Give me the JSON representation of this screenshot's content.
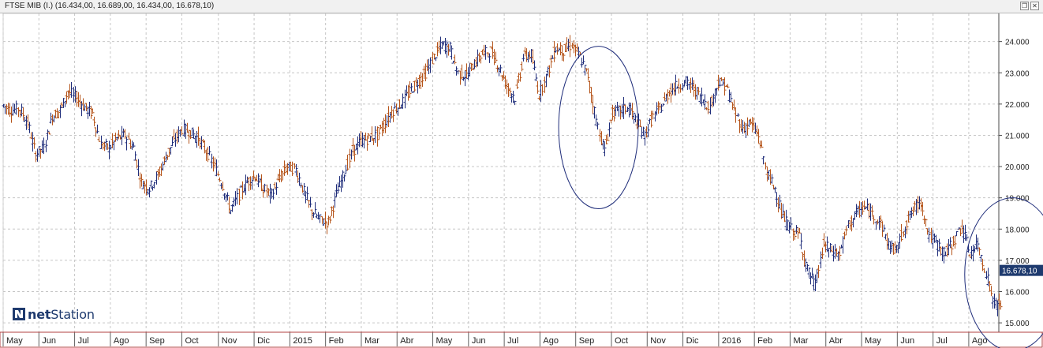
{
  "window": {
    "title": "FTSE MIB (I.) (16.434,00, 16.689,00, 16.434,00, 16.678,10)",
    "restore_glyph": "❐",
    "close_glyph": "✕"
  },
  "logo": {
    "mark": "N",
    "text_bold": "net",
    "text_rest": "Station"
  },
  "colors": {
    "up": "#1f2d7a",
    "down": "#b5541a",
    "grid": "#c6c6c6",
    "axis_line": "#4a4a4a",
    "price_tag": "#1e3a6e",
    "circle": "#1f2d7a",
    "bottom_border": "#b04040"
  },
  "chart_data": {
    "type": "line",
    "style": "ohlc-bars",
    "title": "FTSE MIB (I.)",
    "ylim": [
      14.7,
      24.9
    ],
    "yticks": [
      "15.000",
      "16.000",
      "17.000",
      "18.000",
      "19.000",
      "20.000",
      "21.000",
      "22.000",
      "23.000",
      "24.000"
    ],
    "last_value": "16.678,10",
    "grid": true,
    "xlim": [
      0,
      67.6
    ],
    "x_unit": "week index from start (May 2014)",
    "months": [
      {
        "label": "May",
        "x": 0
      },
      {
        "label": "Jun",
        "x": 4.4
      },
      {
        "label": "Jul",
        "x": 8.8
      },
      {
        "label": "Ago",
        "x": 13.2
      },
      {
        "label": "Sep",
        "x": 17.6
      },
      {
        "label": "Oct",
        "x": 22.0
      },
      {
        "label": "Nov",
        "x": 26.5
      },
      {
        "label": "Dic",
        "x": 30.9
      },
      {
        "label": "2015",
        "x": 35.3
      },
      {
        "label": "Feb",
        "x": 39.7
      },
      {
        "label": "Mar",
        "x": 44.1
      },
      {
        "label": "Abr",
        "x": 48.5
      },
      {
        "label": "May",
        "x": 52.9
      },
      {
        "label": "Jun",
        "x": 57.3
      },
      {
        "label": "Jul",
        "x": 61.7
      },
      {
        "label": "Ago",
        "x": 66.1
      },
      {
        "label": "Sep",
        "x": 70.5
      },
      {
        "label": "Oct",
        "x": 74.9
      },
      {
        "label": "Nov",
        "x": 79.3
      },
      {
        "label": "Dic",
        "x": 83.7
      },
      {
        "label": "2016",
        "x": 88.1
      },
      {
        "label": "Feb",
        "x": 92.5
      },
      {
        "label": "Mar",
        "x": 96.9
      },
      {
        "label": "Abr",
        "x": 101.3
      },
      {
        "label": "May",
        "x": 105.7
      },
      {
        "label": "Jun",
        "x": 110.1
      },
      {
        "label": "Jul",
        "x": 114.5
      },
      {
        "label": "Ago",
        "x": 118.9
      }
    ],
    "series": [
      {
        "x": [
          0,
          1,
          2,
          3,
          4,
          5,
          6,
          7,
          8,
          9,
          10,
          11,
          12,
          13,
          14,
          15,
          16,
          17,
          18,
          19,
          20,
          21,
          22,
          23,
          24,
          25,
          26,
          27,
          28,
          29,
          30,
          31,
          32,
          33,
          34,
          35,
          36,
          37,
          38,
          39,
          40,
          41,
          42,
          43,
          44,
          45,
          46,
          47,
          48,
          49,
          50,
          51,
          52,
          53,
          54,
          55,
          56,
          57,
          58,
          59,
          60,
          61,
          62,
          63,
          64,
          65,
          66,
          67,
          68,
          69,
          70,
          71,
          72,
          73,
          74,
          75,
          76,
          77,
          78,
          79,
          80,
          81,
          82,
          83,
          84,
          85,
          86,
          87,
          88,
          89,
          90,
          91,
          92,
          93,
          94,
          95,
          96,
          97,
          98,
          99,
          100,
          101,
          102,
          103,
          104,
          105,
          106,
          107,
          108,
          109,
          110,
          111,
          112,
          113,
          114,
          115,
          116,
          117,
          118,
          119,
          120,
          121,
          122
        ],
        "values": [
          21.95,
          21.8,
          21.85,
          21.4,
          20.4,
          20.6,
          21.6,
          21.8,
          22.4,
          22.2,
          21.9,
          21.7,
          20.7,
          20.6,
          20.9,
          21.0,
          20.6,
          19.5,
          19.3,
          19.7,
          20.3,
          20.8,
          21.2,
          21.1,
          20.9,
          20.5,
          20.0,
          19.4,
          18.6,
          19.1,
          19.5,
          19.7,
          19.3,
          19.1,
          19.6,
          20.0,
          19.9,
          19.2,
          18.6,
          18.3,
          18.2,
          19.1,
          19.8,
          20.5,
          20.8,
          20.9,
          21.0,
          21.4,
          21.8,
          22.0,
          22.4,
          22.7,
          23.0,
          23.5,
          23.9,
          23.8,
          23.0,
          22.9,
          23.3,
          23.6,
          23.7,
          23.2,
          22.6,
          22.2,
          23.5,
          23.6,
          22.3,
          23.0,
          23.8,
          23.7,
          23.9,
          23.5,
          22.9,
          21.5,
          20.5,
          21.7,
          21.8,
          21.9,
          21.4,
          21.0,
          21.6,
          21.9,
          22.4,
          22.6,
          22.7,
          22.5,
          22.2,
          21.9,
          22.7,
          22.6,
          21.8,
          21.2,
          21.4,
          21.0,
          19.8,
          19.3,
          18.4,
          18.0,
          17.8,
          16.7,
          16.2,
          17.5,
          17.3,
          17.2,
          18.1,
          18.5,
          18.7,
          18.5,
          18.2,
          17.5,
          17.3,
          18.1,
          18.6,
          18.9,
          17.8,
          17.5,
          17.2,
          17.6,
          18.1,
          17.2,
          17.5,
          16.6,
          15.6
        ]
      }
    ],
    "annotations": [
      {
        "type": "circle",
        "cx": 73.3,
        "cy": 21.25,
        "rx": 4.9,
        "ry": 2.6
      },
      {
        "type": "circle",
        "cx": 124.3,
        "cy": 16.55,
        "rx": 5.9,
        "ry": 2.45
      }
    ]
  }
}
